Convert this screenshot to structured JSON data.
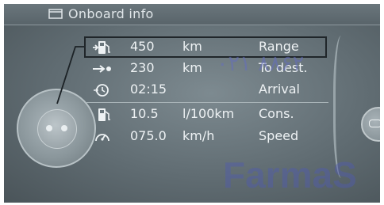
{
  "header": {
    "title": "Onboard info",
    "icon": "document-icon"
  },
  "rows": [
    {
      "icon": "fuel-range-icon",
      "value": "450",
      "unit": "km",
      "label": "Range",
      "selected": true
    },
    {
      "icon": "destination-arrow-icon",
      "value": "230",
      "unit": "km",
      "label": "To dest.",
      "selected": false
    },
    {
      "icon": "arrival-clock-icon",
      "value": "02:15",
      "unit": "",
      "label": "Arrival",
      "selected": false
    },
    {
      "icon": "fuel-pump-icon",
      "value": "10.5",
      "unit": "l/100km",
      "label": "Cons.",
      "selected": false
    },
    {
      "icon": "speedometer-icon",
      "value": "075.0",
      "unit": "km/h",
      "label": "Speed",
      "selected": false
    }
  ],
  "watermark": {
    "digits": "۰۲۱ ۸۸۶۲",
    "brand": "FarmaS"
  },
  "colors": {
    "screen_bg": "#606c72",
    "text": "#eef2f4",
    "selection_border": "#20262a",
    "watermark": "#5a64b4"
  }
}
